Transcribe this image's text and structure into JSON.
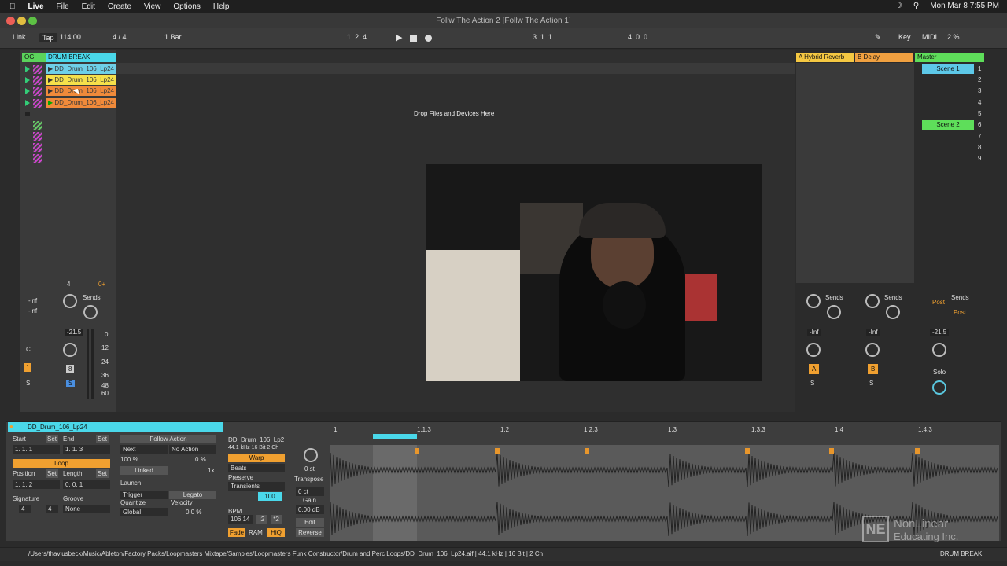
{
  "menubar": {
    "app": "Live",
    "items": [
      "File",
      "Edit",
      "Create",
      "View",
      "Options",
      "Help"
    ],
    "datetime": "Mon Mar 8  7:55 PM"
  },
  "window": {
    "title": "Follw The Action 2  [Follw The Action 1]"
  },
  "transport": {
    "link": "Link",
    "tap": "Tap",
    "tempo": "114.00",
    "signature": "4 / 4",
    "quantize": "1 Bar",
    "arrangement_position": "1.  2.  4",
    "loop_start": "3.  1.  1",
    "loop_length": "4.  0.  0",
    "key": "Key",
    "midi": "MIDI",
    "cpu": "2 %"
  },
  "session": {
    "track": {
      "name": "DRUM BREAK",
      "chain_label": "OG",
      "clips": [
        "DD_Drum_106_Lp24",
        "DD_Drum_106_Lp24",
        "DD_Drum_106_Lp24",
        "DD_Drum_106_Lp24"
      ]
    },
    "drop_hint": "Drop Files and Devices Here",
    "returns": [
      {
        "name": "A Hybrid Reverb"
      },
      {
        "name": "B Delay"
      }
    ],
    "master": {
      "name": "Master",
      "scenes": [
        {
          "n": "1",
          "label": "Scene 1"
        },
        {
          "n": "2",
          "label": ""
        },
        {
          "n": "3",
          "label": ""
        },
        {
          "n": "4",
          "label": ""
        },
        {
          "n": "5",
          "label": ""
        },
        {
          "n": "6",
          "label": "Scene 2"
        },
        {
          "n": "7",
          "label": ""
        },
        {
          "n": "8",
          "label": ""
        },
        {
          "n": "9",
          "label": ""
        }
      ]
    },
    "mixer": {
      "track_volume": "-21.5",
      "master_volume": "-21.5",
      "return_a_volume": "-Inf",
      "return_b_volume": "-Inf",
      "sends_label": "Sends",
      "inf_labels": [
        "-inf",
        "-inf"
      ],
      "track_num": "4",
      "input_num": "0+",
      "track_number_button": "1",
      "solo": "S",
      "cue": "C",
      "record_arm": "8",
      "db_scale": [
        "0",
        "12",
        "24",
        "36",
        "48",
        "60"
      ],
      "post": "Post",
      "a": "A",
      "b": "B",
      "solo_label": "Solo"
    }
  },
  "clip_detail": {
    "clip_name": "DD_Drum_106_Lp24",
    "start_label": "Start",
    "end_label": "End",
    "set": "Set",
    "start": "1.   1.   1",
    "end": "1.   1.   3",
    "loop": "Loop",
    "position_label": "Position",
    "length_label": "Length",
    "position": "1.   1.   2",
    "length": "0.   0.   1",
    "signature_label": "Signature",
    "groove_label": "Groove",
    "sig_num": "4",
    "sig_den": "4",
    "groove": "None",
    "follow_action": "Follow Action",
    "next": "Next",
    "no_action": "No Action",
    "chance_a": "100 %",
    "chance_b": "0 %",
    "linked": "Linked",
    "follow_time": "1x",
    "launch": "Launch",
    "trigger": "Trigger",
    "legato": "Legato",
    "quantize_label": "Quantize",
    "velocity_label": "Velocity",
    "quantize": "Global",
    "velocity": "0.0 %",
    "sample_name": "DD_Drum_106_Lp2",
    "sample_info": "44.1 kHz  16 Bit  2 Ch",
    "warp": "Warp",
    "warp_mode": "Beats",
    "preserve_label": "Preserve",
    "preserve": "Transients",
    "loop_value": "100",
    "bpm_label": "BPM",
    "bpm": "106.14",
    "half": ":2",
    "double": "*2",
    "transpose_label": "Transpose",
    "transpose": "0 st",
    "detune": "0 ct",
    "gain_label": "Gain",
    "gain": "0.00 dB",
    "edit": "Edit",
    "reverse": "Reverse",
    "fade": "Fade",
    "ram": "RAM",
    "hiq": "HiQ",
    "ruler": [
      "1",
      "1.1.3",
      "1.2",
      "1.2.3",
      "1.3",
      "1.3.3",
      "1.4",
      "1.4.3"
    ]
  },
  "status": {
    "path": "/Users/thaviusbeck/Music/Ableton/Factory Packs/Loopmasters Mixtape/Samples/Loopmasters Funk Constructor/Drum and Perc Loops/DD_Drum_106_Lp24.aif | 44.1 kHz | 16 Bit | 2 Ch",
    "track": "DRUM BREAK"
  },
  "watermark": {
    "line1": "NonLinear",
    "line2": "Educating Inc."
  },
  "colors": {
    "track": "#3ed6e8",
    "clip_yellow": "#f5e04a",
    "clip_orange": "#f08a3a",
    "clip_blue": "#4ac6e0",
    "return_a": "#f5c842",
    "return_b": "#f0a040",
    "master": "#5ede5a",
    "accent": "#f0a030"
  }
}
